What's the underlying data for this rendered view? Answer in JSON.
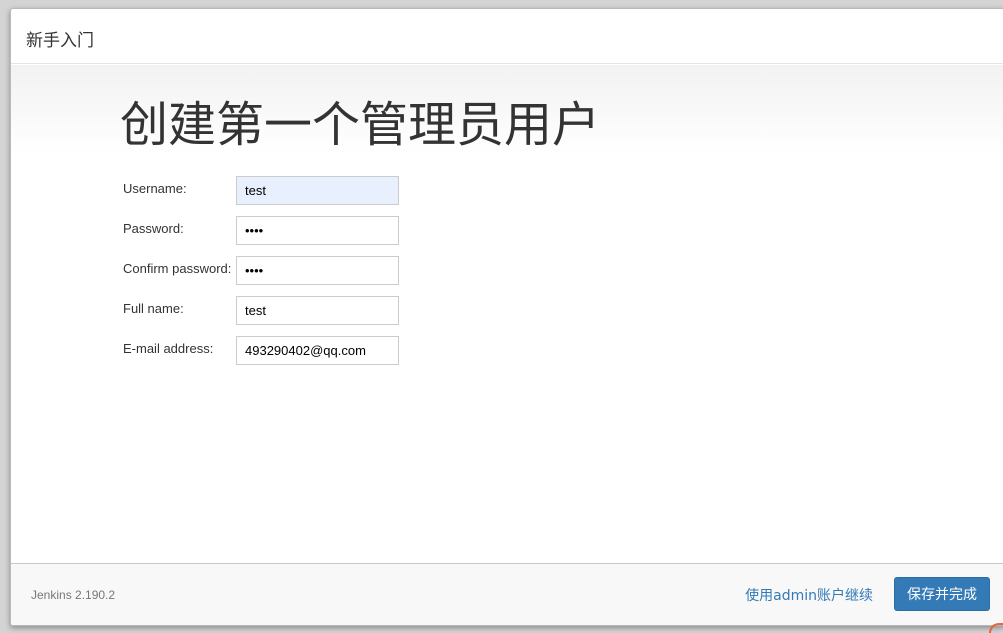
{
  "dialog": {
    "title": "新手入门"
  },
  "page": {
    "heading": "创建第一个管理员用户"
  },
  "form": {
    "username": {
      "label": "Username:",
      "value": "test"
    },
    "password": {
      "label": "Password:",
      "value": "••••"
    },
    "confirm_password": {
      "label": "Confirm password:",
      "value": "••••"
    },
    "full_name": {
      "label": "Full name:",
      "value": "test"
    },
    "email": {
      "label": "E-mail address:",
      "value": "493290402@qq.com"
    }
  },
  "footer": {
    "version": "Jenkins 2.190.2",
    "continue_as_admin": "使用admin账户继续",
    "save_and_finish": "保存并完成"
  },
  "colors": {
    "primary": "#337ab7",
    "autofill_bg": "#e8f0fe"
  }
}
